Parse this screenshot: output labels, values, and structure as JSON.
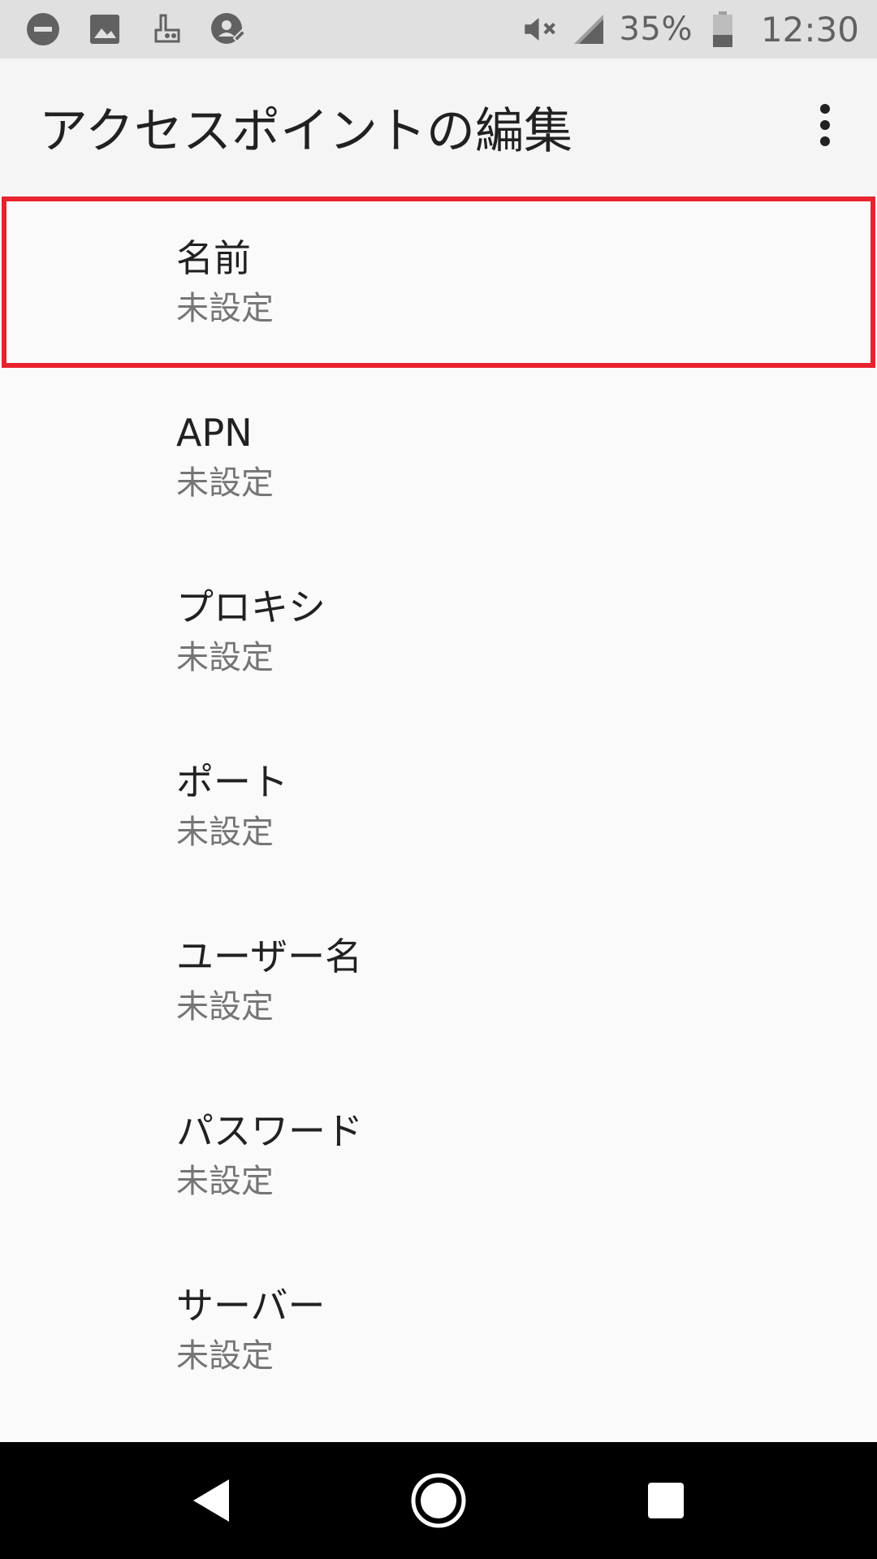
{
  "status_bar": {
    "icons_left": [
      "dnd-icon",
      "image-icon",
      "app-notification-icon",
      "sync-icon"
    ],
    "icons_right": [
      "mute-icon",
      "signal-icon"
    ],
    "battery_percent": "35%",
    "time": "12:30"
  },
  "app_bar": {
    "title": "アクセスポイントの編集",
    "overflow_icon": "more-vert-icon"
  },
  "preferences": [
    {
      "title": "名前",
      "summary": "未設定"
    },
    {
      "title": "APN",
      "summary": "未設定"
    },
    {
      "title": "プロキシ",
      "summary": "未設定"
    },
    {
      "title": "ポート",
      "summary": "未設定"
    },
    {
      "title": "ユーザー名",
      "summary": "未設定"
    },
    {
      "title": "パスワード",
      "summary": "未設定"
    },
    {
      "title": "サーバー",
      "summary": "未設定"
    }
  ],
  "nav_bar": {
    "buttons": [
      "back-icon",
      "home-icon",
      "recents-icon"
    ]
  },
  "colors": {
    "highlight": "#e8232f",
    "status_bar": "#e0e0e0",
    "app_bar": "#f5f5f5",
    "background": "#fafafa"
  }
}
